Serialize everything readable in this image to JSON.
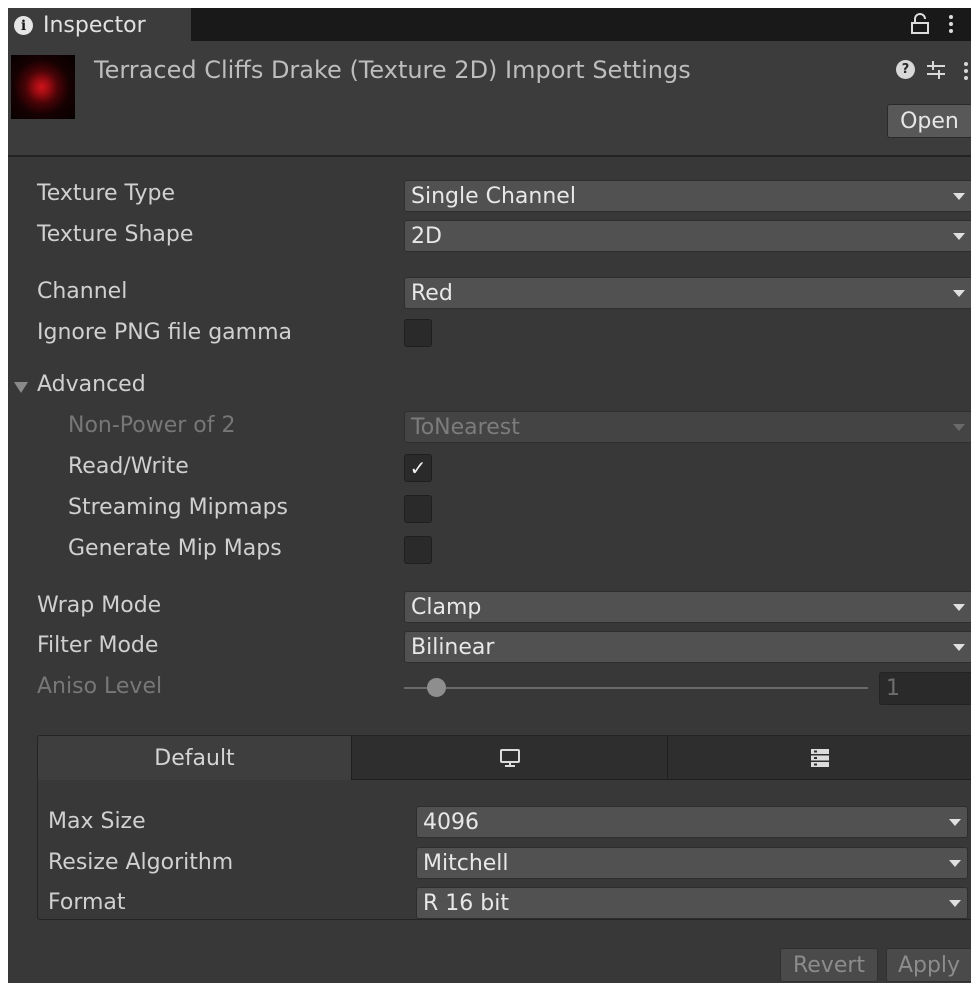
{
  "window": {
    "tab_label": "Inspector",
    "icons": [
      "info-icon",
      "lock-icon",
      "more-vertical-icon"
    ]
  },
  "header": {
    "title": "Terraced Cliffs Drake (Texture 2D) Import Settings",
    "open_label": "Open",
    "icons": [
      "help-icon",
      "preset-icon",
      "more-vertical-icon"
    ]
  },
  "settings": {
    "texture_type": {
      "label": "Texture Type",
      "value": "Single Channel"
    },
    "texture_shape": {
      "label": "Texture Shape",
      "value": "2D"
    },
    "channel": {
      "label": "Channel",
      "value": "Red"
    },
    "ignore_png_gamma": {
      "label": "Ignore PNG file gamma",
      "checked": false
    },
    "advanced": {
      "label": "Advanced",
      "expanded": true,
      "non_power_of_2": {
        "label": "Non-Power of 2",
        "value": "ToNearest",
        "enabled": false
      },
      "read_write": {
        "label": "Read/Write",
        "checked": true,
        "check_glyph": "✓"
      },
      "streaming_mipmaps": {
        "label": "Streaming Mipmaps",
        "checked": false
      },
      "generate_mip_maps": {
        "label": "Generate Mip Maps",
        "checked": false
      }
    },
    "wrap_mode": {
      "label": "Wrap Mode",
      "value": "Clamp"
    },
    "filter_mode": {
      "label": "Filter Mode",
      "value": "Bilinear"
    },
    "aniso_level": {
      "label": "Aniso Level",
      "value": "1",
      "slider_fraction": 0.07,
      "enabled": false
    }
  },
  "platform": {
    "tabs": [
      {
        "label": "Default",
        "active": true
      },
      {
        "icon": "monitor-icon",
        "active": false
      },
      {
        "icon": "server-icon",
        "active": false
      }
    ],
    "max_size": {
      "label": "Max Size",
      "value": "4096"
    },
    "resize_algorithm": {
      "label": "Resize Algorithm",
      "value": "Mitchell"
    },
    "format": {
      "label": "Format",
      "value": "R 16 bit"
    }
  },
  "footer": {
    "revert_label": "Revert",
    "apply_label": "Apply"
  }
}
